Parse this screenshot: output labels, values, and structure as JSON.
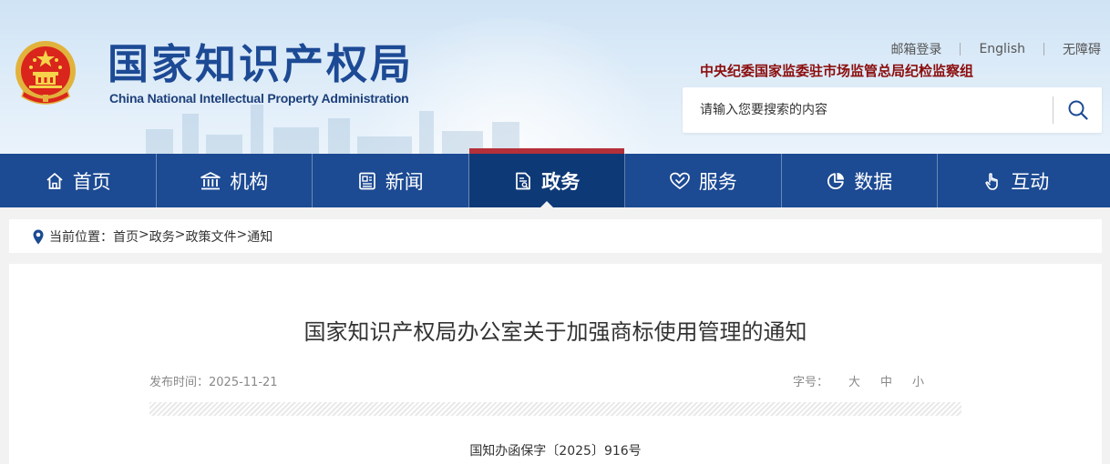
{
  "header": {
    "logo_cn": "国家知识产权局",
    "logo_en": "China National Intellectual Property Administration",
    "top_links": [
      "邮箱登录",
      "English",
      "无障碍"
    ],
    "notice_line": "中央纪委国家监委驻市场监管总局纪检监察组",
    "search_placeholder": "请输入您要搜索的内容",
    "icons": {
      "emblem": "national-emblem-icon",
      "search": "search-icon"
    }
  },
  "nav": {
    "items": [
      {
        "label": "首页",
        "icon": "home-icon"
      },
      {
        "label": "机构",
        "icon": "institution-icon"
      },
      {
        "label": "新闻",
        "icon": "news-icon"
      },
      {
        "label": "政务",
        "icon": "document-icon"
      },
      {
        "label": "服务",
        "icon": "service-icon"
      },
      {
        "label": "数据",
        "icon": "pie-chart-icon"
      },
      {
        "label": "互动",
        "icon": "hand-pointer-icon"
      }
    ],
    "active": "政务"
  },
  "breadcrumb": {
    "prefix": "当前位置：",
    "items": [
      "首页",
      "政务",
      "政策文件",
      "通知"
    ],
    "separator": ">",
    "icon": "location-pin-icon"
  },
  "article": {
    "title": "国家知识产权局办公室关于加强商标使用管理的通知",
    "publish_label": "发布时间：",
    "publish_date": "2025-11-21",
    "font_size_label": "字号：",
    "font_size_options": [
      "大",
      "中",
      "小"
    ],
    "doc_number": "国知办函保字〔2025〕916号"
  },
  "colors": {
    "nav_bg": "#1c4a93",
    "nav_active_bg": "#0e3977",
    "nav_active_top": "#b4303a",
    "logo": "#1d4a95",
    "notice": "#8b0d0d"
  }
}
